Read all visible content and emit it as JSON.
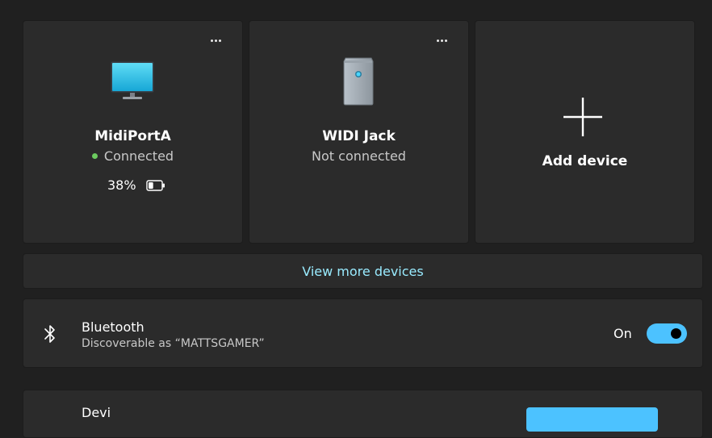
{
  "devices": [
    {
      "name": "MidiPortA",
      "status": "Connected",
      "battery": "38%",
      "battery_level": 0.38,
      "icon": "monitor-icon",
      "connected": true
    },
    {
      "name": "WIDI Jack",
      "status": "Not connected",
      "icon": "desktop-tower-icon",
      "connected": false
    }
  ],
  "add_device": {
    "label": "Add device",
    "icon": "plus-icon"
  },
  "view_more": {
    "label": "View more devices"
  },
  "bluetooth": {
    "title": "Bluetooth",
    "subtitle": "Discoverable as “MATTSGAMER”",
    "state": "On",
    "enabled": true,
    "icon": "bluetooth-icon"
  },
  "next_row": {
    "title": "Devi"
  },
  "colors": {
    "background": "#202020",
    "card": "#2b2b2b",
    "accent": "#4cc2ff",
    "link": "#99ebff",
    "connected_dot": "#6ccb5f"
  }
}
